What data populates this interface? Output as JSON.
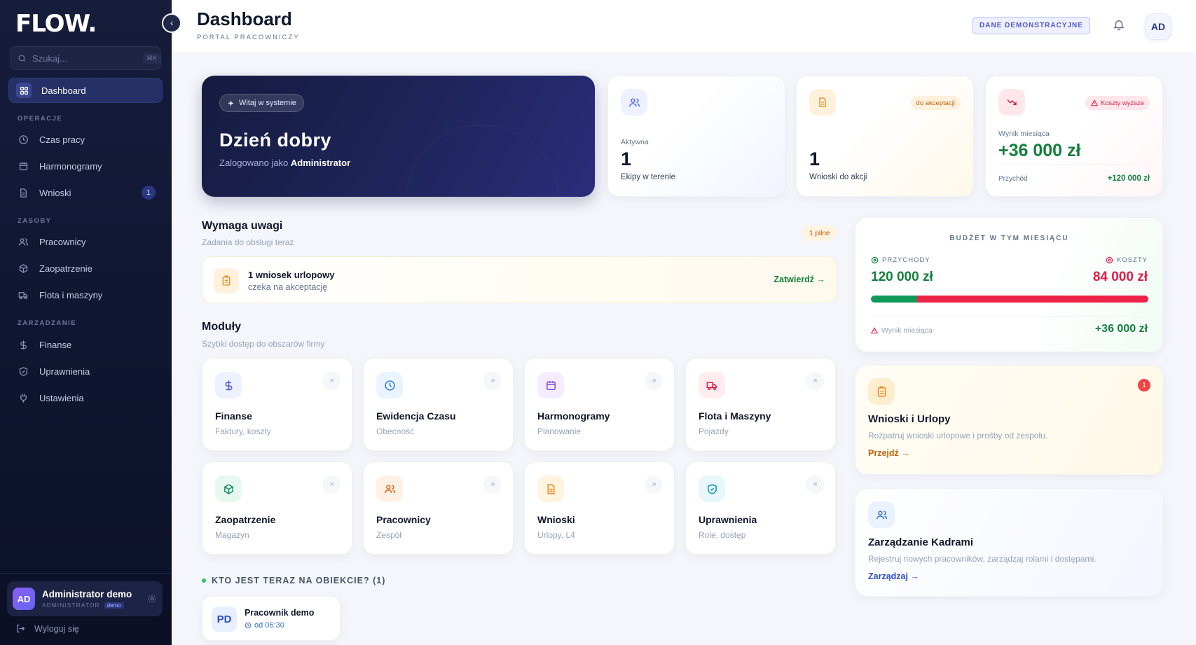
{
  "app": {
    "logo": "FLOW."
  },
  "search": {
    "placeholder": "Szukaj...",
    "shortcut": "⌘K"
  },
  "sidebar": {
    "dashboard": "Dashboard",
    "sections": {
      "operacje": "OPERACJE",
      "zasoby": "ZASOBY",
      "zarzadzanie": "ZARZĄDZANIE"
    },
    "items": {
      "czas": "Czas pracy",
      "harmonogramy": "Harmonogramy",
      "wnioski": "Wnioski",
      "wnioski_badge": "1",
      "pracownicy": "Pracownicy",
      "zaopatrzenie": "Zaopatrzenie",
      "flota": "Flota i maszyny",
      "finanse": "Finanse",
      "uprawnienia": "Uprawnienia",
      "ustawienia": "Ustawienia"
    },
    "user": {
      "initials": "AD",
      "name": "Administrator demo",
      "role": "ADMINISTRATOR",
      "tag": "demo"
    },
    "logout": "Wyloguj się"
  },
  "header": {
    "title": "Dashboard",
    "subtitle": "PORTAL PRACOWNICZY",
    "demo_badge": "DANE DEMONSTRACYJNE",
    "avatar": "AD"
  },
  "hero": {
    "pill": "Witaj w systemie",
    "title": "Dzień dobry",
    "subtitle_prefix": "Zalogowano jako",
    "subtitle_user": "Administrator"
  },
  "stats": {
    "teams": {
      "label": "Aktywna",
      "value": "1",
      "desc": "Ekipy w terenie"
    },
    "requests": {
      "tag": "do akceptacji",
      "value": "1",
      "desc": "Wnioski do akcji"
    },
    "result": {
      "tag": "Koszty wyższe",
      "label": "Wynik miesiąca",
      "value": "+36 000 zł",
      "income_label": "Przychód",
      "income_value": "+120 000 zł"
    }
  },
  "attention": {
    "title": "Wymaga uwagi",
    "subtitle": "Zadania do obsługi teraz",
    "pill": "1 pilne",
    "task_title": "1 wniosek urlopowy",
    "task_sub": "czeka na akceptację",
    "task_action": "Zatwierdź →"
  },
  "modules": {
    "title": "Moduły",
    "subtitle": "Szybki dostęp do obszarów firmy",
    "items": [
      {
        "title": "Finanse",
        "sub": "Faktury, koszty"
      },
      {
        "title": "Ewidencja Czasu",
        "sub": "Obecność"
      },
      {
        "title": "Harmonogramy",
        "sub": "Planowanie"
      },
      {
        "title": "Flota i Maszyny",
        "sub": "Pojazdy"
      },
      {
        "title": "Zaopatrzenie",
        "sub": "Magazyn"
      },
      {
        "title": "Pracownicy",
        "sub": "Zespół"
      },
      {
        "title": "Wnioski",
        "sub": "Urlopy, L4"
      },
      {
        "title": "Uprawnienia",
        "sub": "Role, dostęp"
      }
    ]
  },
  "onsite": {
    "title": "KTO JEST TERAZ NA OBIEKCIE? (1)",
    "person": {
      "initials": "PD",
      "name": "Pracownik demo",
      "since": "od 06:30"
    }
  },
  "budget": {
    "title": "BUDŻET W TYM MIESIĄCU",
    "income_label": "PRZYCHODY",
    "income_value": "120 000 zł",
    "cost_label": "KOSZTY",
    "cost_value": "84 000 zł",
    "income_share": 0.1667,
    "result_label": "Wynik miesiąca",
    "result_value": "+36 000 zł"
  },
  "panels": {
    "leave": {
      "title": "Wnioski i Urlopy",
      "sub": "Rozpatruj wnioski urlopowe i prośby od zespołu.",
      "link": "Przejdź →",
      "badge": "1"
    },
    "hr": {
      "title": "Zarządzanie Kadrami",
      "sub": "Rejestruj nowych pracowników, zarządzaj rolami i dostępami.",
      "link": "Zarządzaj →"
    }
  },
  "colors": {
    "accent": "#2a3680",
    "green": "#15803d",
    "red": "#e11d48",
    "orange": "#ea8a1e"
  }
}
